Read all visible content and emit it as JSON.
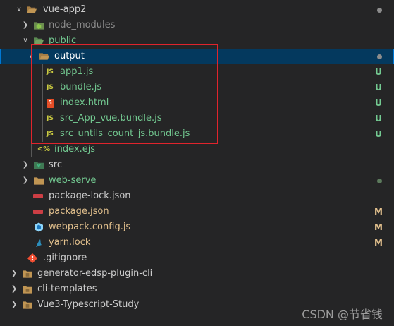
{
  "colors": {
    "folder": "#c09553",
    "untracked_green": "#73c991",
    "modified_yellow": "#e2c08d",
    "ignored_gray": "#8c8c8c",
    "default_text": "#cccccc",
    "selected_bg": "#04395e",
    "highlight_box": "#e0242c"
  },
  "tree": [
    {
      "label": "vue-app2",
      "icon": "folder-open-icon",
      "state": "expanded",
      "status": "dot"
    },
    {
      "label": "node_modules",
      "icon": "node-folder-icon",
      "state": "collapsed"
    },
    {
      "label": "public",
      "icon": "folder-open-icon",
      "state": "expanded"
    },
    {
      "label": "output",
      "icon": "folder-open-icon",
      "state": "expanded",
      "status": "dot",
      "selected": true
    },
    {
      "label": "app1.js",
      "icon": "js-file-icon",
      "status": "U"
    },
    {
      "label": "bundle.js",
      "icon": "js-file-icon",
      "status": "U"
    },
    {
      "label": "index.html",
      "icon": "html-file-icon",
      "status": "U"
    },
    {
      "label": "src_App_vue.bundle.js",
      "icon": "js-file-icon",
      "status": "U"
    },
    {
      "label": "src_untils_count_js.bundle.js",
      "icon": "js-file-icon",
      "status": "U"
    },
    {
      "label": "index.ejs",
      "icon": "ejs-file-icon"
    },
    {
      "label": "src",
      "icon": "vue-folder-icon",
      "state": "collapsed"
    },
    {
      "label": "web-serve",
      "icon": "folder-icon",
      "state": "collapsed",
      "status": "dot"
    },
    {
      "label": "package-lock.json",
      "icon": "npm-file-icon"
    },
    {
      "label": "package.json",
      "icon": "npm-file-icon",
      "status": "M"
    },
    {
      "label": "webpack.config.js",
      "icon": "webpack-file-icon",
      "status": "M"
    },
    {
      "label": "yarn.lock",
      "icon": "yarn-file-icon",
      "status": "M"
    },
    {
      "label": ".gitignore",
      "icon": "git-file-icon"
    },
    {
      "label": "generator-edsp-plugin-cli",
      "icon": "folder-icon",
      "state": "collapsed"
    },
    {
      "label": "cli-templates",
      "icon": "folder-icon",
      "state": "collapsed"
    },
    {
      "label": "Vue3-Typescript-Study",
      "icon": "folder-icon",
      "state": "collapsed"
    }
  ],
  "watermark": "CSDN @节省钱"
}
